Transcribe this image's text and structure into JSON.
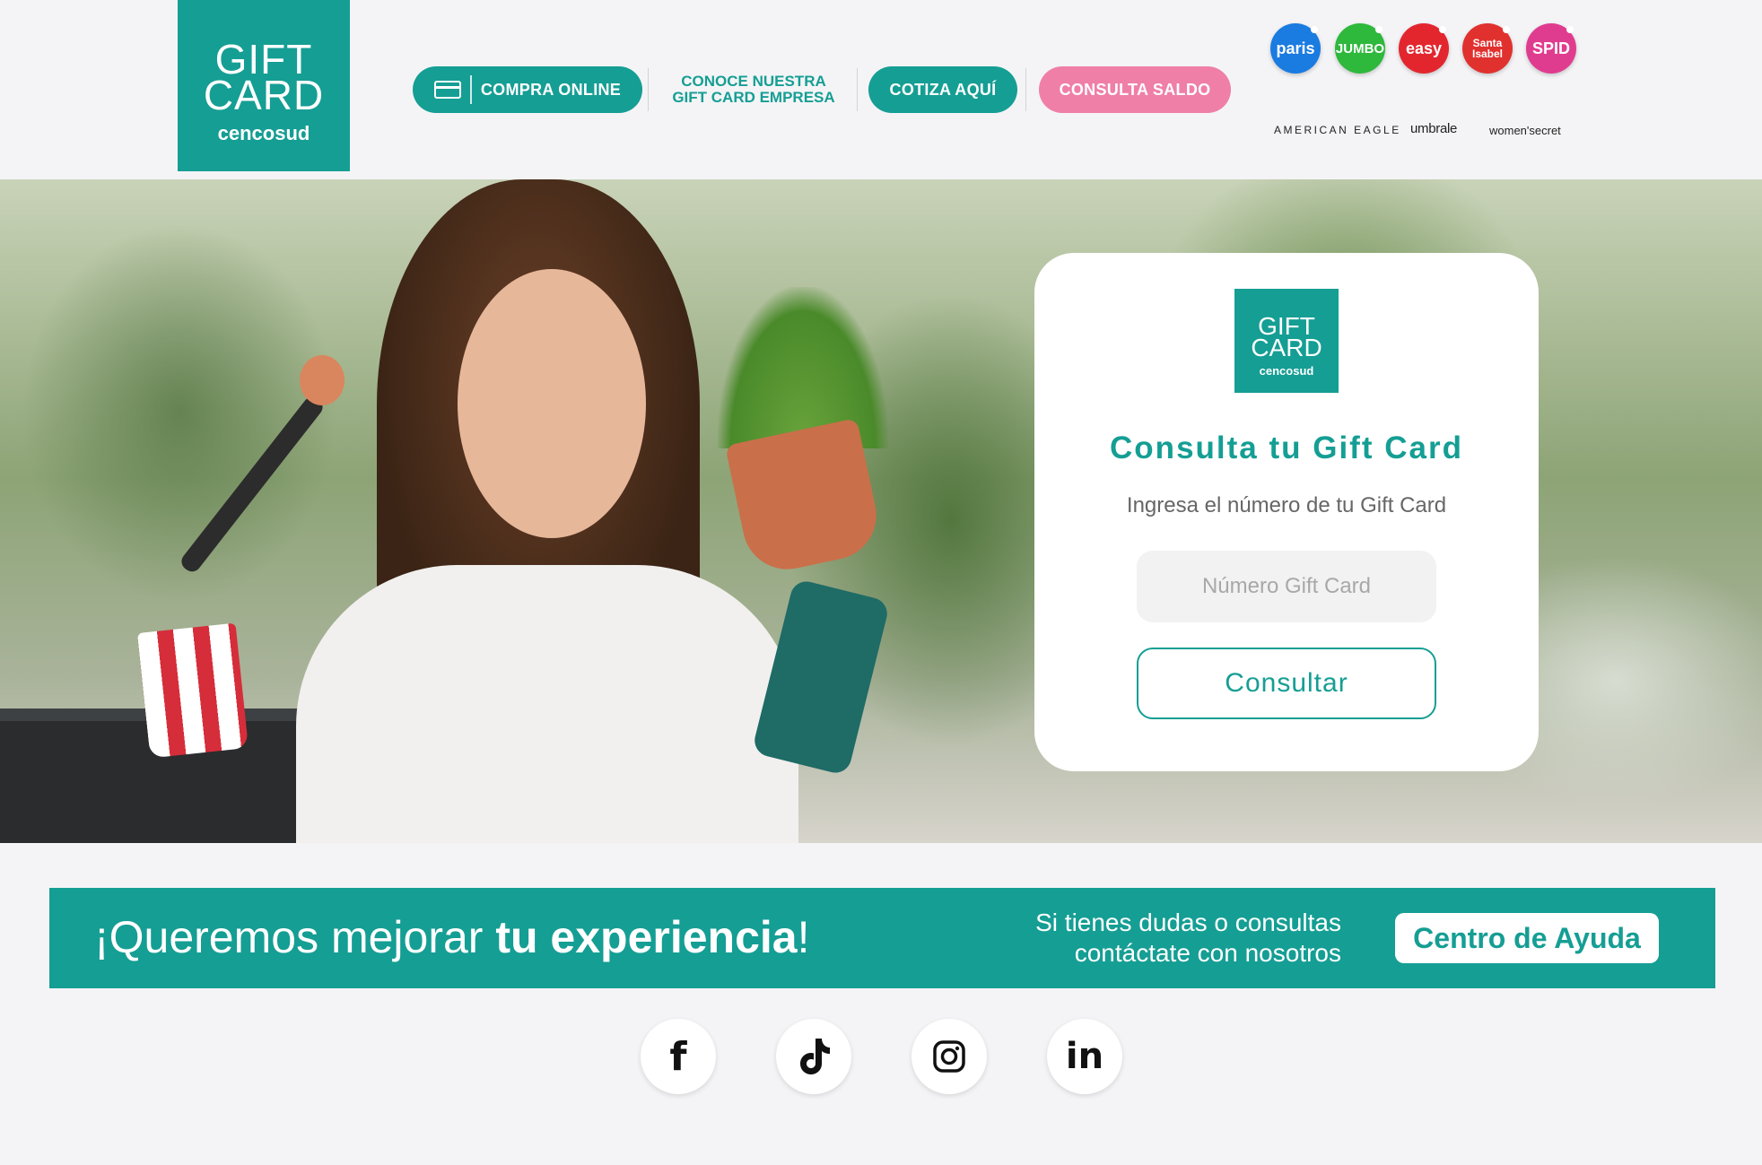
{
  "header": {
    "logo": {
      "line1": "GIFT",
      "line2": "CARD",
      "line3": "cencosud"
    },
    "nav": {
      "compra_online": "COMPRA ONLINE",
      "conoce_line1": "CONOCE NUESTRA",
      "conoce_line2": "GIFT CARD EMPRESA",
      "cotiza": "COTIZA AQUÍ",
      "consulta_saldo": "CONSULTA SALDO"
    },
    "brands": {
      "paris": "paris",
      "jumbo": "JUMBO",
      "easy": "easy",
      "santa_isabel_1": "Santa",
      "santa_isabel_2": "Isabel",
      "spid": "SPID",
      "american_eagle": "AMERICAN EAGLE",
      "umbrale": "umbrale",
      "womensecret": "women'secret"
    }
  },
  "card": {
    "logo": {
      "line1": "GIFT",
      "line2": "CARD",
      "line3": "cencosud"
    },
    "title": "Consulta tu Gift Card",
    "subtitle": "Ingresa el número de tu Gift Card",
    "input_placeholder": "Número Gift Card",
    "button": "Consultar"
  },
  "banner": {
    "headline_start": "¡Queremos mejorar ",
    "headline_bold": "tu experiencia",
    "headline_end": "!",
    "help_line1": "Si tienes dudas o consultas",
    "help_line2": "contáctate con nosotros",
    "help_button": "Centro de Ayuda"
  },
  "social": {
    "facebook": "f",
    "tiktok": "tiktok-icon",
    "instagram": "instagram-icon",
    "linkedin": "in"
  },
  "colors": {
    "teal": "#159e94",
    "pink": "#ef7fa6",
    "background": "#f4f4f6"
  }
}
